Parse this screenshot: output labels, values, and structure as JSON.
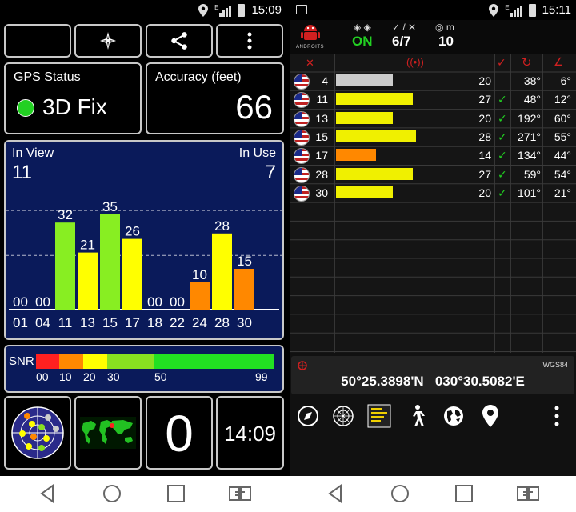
{
  "left_status": {
    "time": "15:09",
    "net": "E"
  },
  "right_status": {
    "time": "15:11",
    "net": "E"
  },
  "left": {
    "buttons": [
      "moon-icon",
      "star-icon",
      "share-icon",
      "more-vert-icon"
    ],
    "gps_status": {
      "label": "GPS Status",
      "value": "3D Fix",
      "dot_color": "#22d022"
    },
    "accuracy": {
      "label": "Accuracy (feet)",
      "value": "66"
    },
    "chart": {
      "in_view_label": "In View",
      "in_view": "11",
      "in_use_label": "In Use",
      "in_use": "7"
    },
    "snr": {
      "label": "SNR",
      "ticks": [
        "00",
        "10",
        "20",
        "30",
        "50",
        "99"
      ]
    },
    "tiles": {
      "counter": "0",
      "clock": "14:09"
    }
  },
  "chart_data": {
    "type": "bar",
    "categories": [
      "01",
      "04",
      "11",
      "13",
      "15",
      "17",
      "18",
      "22",
      "24",
      "28",
      "30"
    ],
    "values": [
      0,
      0,
      32,
      21,
      35,
      26,
      0,
      0,
      10,
      28,
      15
    ],
    "value_labels": [
      "00",
      "00",
      "32",
      "21",
      "35",
      "26",
      "00",
      "00",
      "10",
      "28",
      "15"
    ],
    "colors": [
      "#ffff00",
      "#ffff00",
      "#88ee22",
      "#ffff00",
      "#88ee22",
      "#ffff00",
      "#ffff00",
      "#ffff00",
      "#ff8800",
      "#ffff00",
      "#ff8800"
    ],
    "ylim": [
      0,
      50
    ]
  },
  "right": {
    "header": {
      "status_value": "ON",
      "used_value": "6/7",
      "accuracy_unit": "m",
      "accuracy_value": "10",
      "logo_text": "ANDROITS"
    },
    "satellites": [
      {
        "id": "4",
        "snr": "20",
        "used": "–",
        "az": "38°",
        "el": "6°",
        "bar_color": "#cccccc",
        "bar": 20
      },
      {
        "id": "11",
        "snr": "27",
        "used": "✓",
        "az": "48°",
        "el": "12°",
        "bar_color": "#f0f000",
        "bar": 27
      },
      {
        "id": "13",
        "snr": "20",
        "used": "✓",
        "az": "192°",
        "el": "60°",
        "bar_color": "#f0f000",
        "bar": 20
      },
      {
        "id": "15",
        "snr": "28",
        "used": "✓",
        "az": "271°",
        "el": "55°",
        "bar_color": "#f0f000",
        "bar": 28
      },
      {
        "id": "17",
        "snr": "14",
        "used": "✓",
        "az": "134°",
        "el": "44°",
        "bar_color": "#ff8800",
        "bar": 14
      },
      {
        "id": "28",
        "snr": "27",
        "used": "✓",
        "az": "59°",
        "el": "54°",
        "bar_color": "#f0f000",
        "bar": 27
      },
      {
        "id": "30",
        "snr": "20",
        "used": "✓",
        "az": "101°",
        "el": "21°",
        "bar_color": "#f0f000",
        "bar": 20
      }
    ],
    "coords": {
      "datum": "WGS84",
      "lat": "50°25.3898'N",
      "lon": "030°30.5082'E"
    }
  }
}
